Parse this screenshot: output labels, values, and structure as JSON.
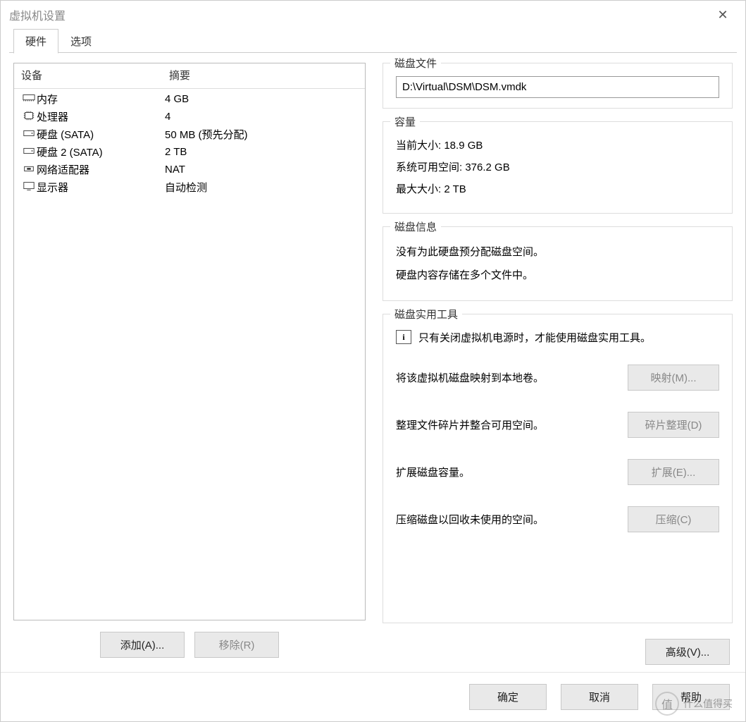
{
  "window": {
    "title": "虚拟机设置"
  },
  "tabs": {
    "hardware": "硬件",
    "options": "选项"
  },
  "deviceTable": {
    "headerDevice": "设备",
    "headerSummary": "摘要",
    "rows": [
      {
        "icon": "memory",
        "label": "内存",
        "summary": "4 GB"
      },
      {
        "icon": "cpu",
        "label": "处理器",
        "summary": "4"
      },
      {
        "icon": "disk",
        "label": "硬盘 (SATA)",
        "summary": "50 MB (预先分配)"
      },
      {
        "icon": "disk",
        "label": "硬盘 2 (SATA)",
        "summary": "2 TB"
      },
      {
        "icon": "network",
        "label": "网络适配器",
        "summary": "NAT"
      },
      {
        "icon": "display",
        "label": "显示器",
        "summary": "自动检测"
      }
    ]
  },
  "buttons": {
    "add": "添加(A)...",
    "remove": "移除(R)",
    "ok": "确定",
    "cancel": "取消",
    "help": "帮助",
    "advanced": "高级(V)..."
  },
  "diskFile": {
    "title": "磁盘文件",
    "path": "D:\\Virtual\\DSM\\DSM.vmdk"
  },
  "capacity": {
    "title": "容量",
    "currentLabel": "当前大小:",
    "currentValue": "18.9 GB",
    "freeLabel": "系统可用空间:",
    "freeValue": "376.2 GB",
    "maxLabel": "最大大小:",
    "maxValue": "2 TB"
  },
  "diskInfo": {
    "title": "磁盘信息",
    "line1": "没有为此硬盘预分配磁盘空间。",
    "line2": "硬盘内容存储在多个文件中。"
  },
  "utilities": {
    "title": "磁盘实用工具",
    "note": "只有关闭虚拟机电源时，才能使用磁盘实用工具。",
    "map": {
      "desc": "将该虚拟机磁盘映射到本地卷。",
      "btn": "映射(M)..."
    },
    "defrag": {
      "desc": "整理文件碎片并整合可用空间。",
      "btn": "碎片整理(D)"
    },
    "expand": {
      "desc": "扩展磁盘容量。",
      "btn": "扩展(E)..."
    },
    "compact": {
      "desc": "压缩磁盘以回收未使用的空间。",
      "btn": "压缩(C)"
    }
  },
  "watermark": {
    "badge": "值",
    "text": "什么值得买"
  }
}
